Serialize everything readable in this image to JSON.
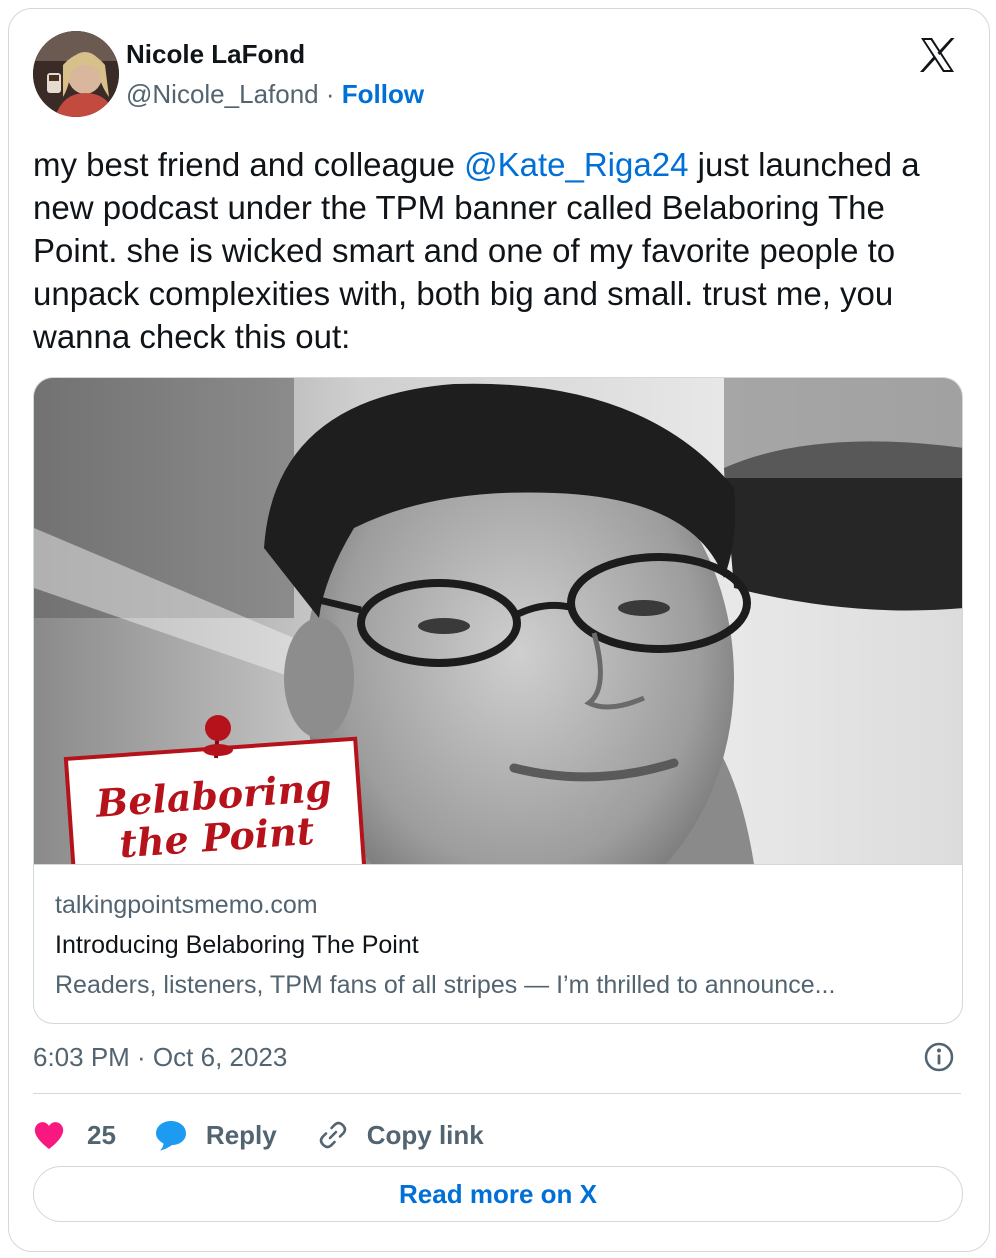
{
  "author": {
    "name": "Nicole LaFond",
    "handle": "@Nicole_Lafond",
    "separator": "·",
    "follow_label": "Follow"
  },
  "tweet": {
    "text_before": "my best friend and colleague ",
    "mention": "@Kate_Riga24",
    "text_after": " just launched a new podcast under the TPM banner called Belaboring The Point. she is wicked smart and one of my favorite people to unpack complexities with, both big and small. trust me, you wanna check this out:"
  },
  "link_card": {
    "image_label_line1": "Belaboring",
    "image_label_line2": "the Point",
    "domain": "talkingpointsmemo.com",
    "title": "Introducing Belaboring The Point",
    "description": "Readers, listeners, TPM fans of all stripes —  I’m thrilled to announce..."
  },
  "timestamp": "6:03 PM · Oct 6, 2023",
  "actions": {
    "like_count": "25",
    "reply_label": "Reply",
    "copy_label": "Copy link"
  },
  "read_more_label": "Read more on X",
  "icons": {
    "logo": "x-logo-icon",
    "info": "info-icon",
    "like": "heart-icon",
    "reply": "speech-bubble-icon",
    "copy": "link-icon"
  },
  "colors": {
    "link_blue": "#006fd6",
    "like_pink": "#f91880",
    "reply_blue": "#1d9bf0",
    "muted": "#536471",
    "border": "#cfd9de",
    "podcast_red": "#b5121b"
  }
}
